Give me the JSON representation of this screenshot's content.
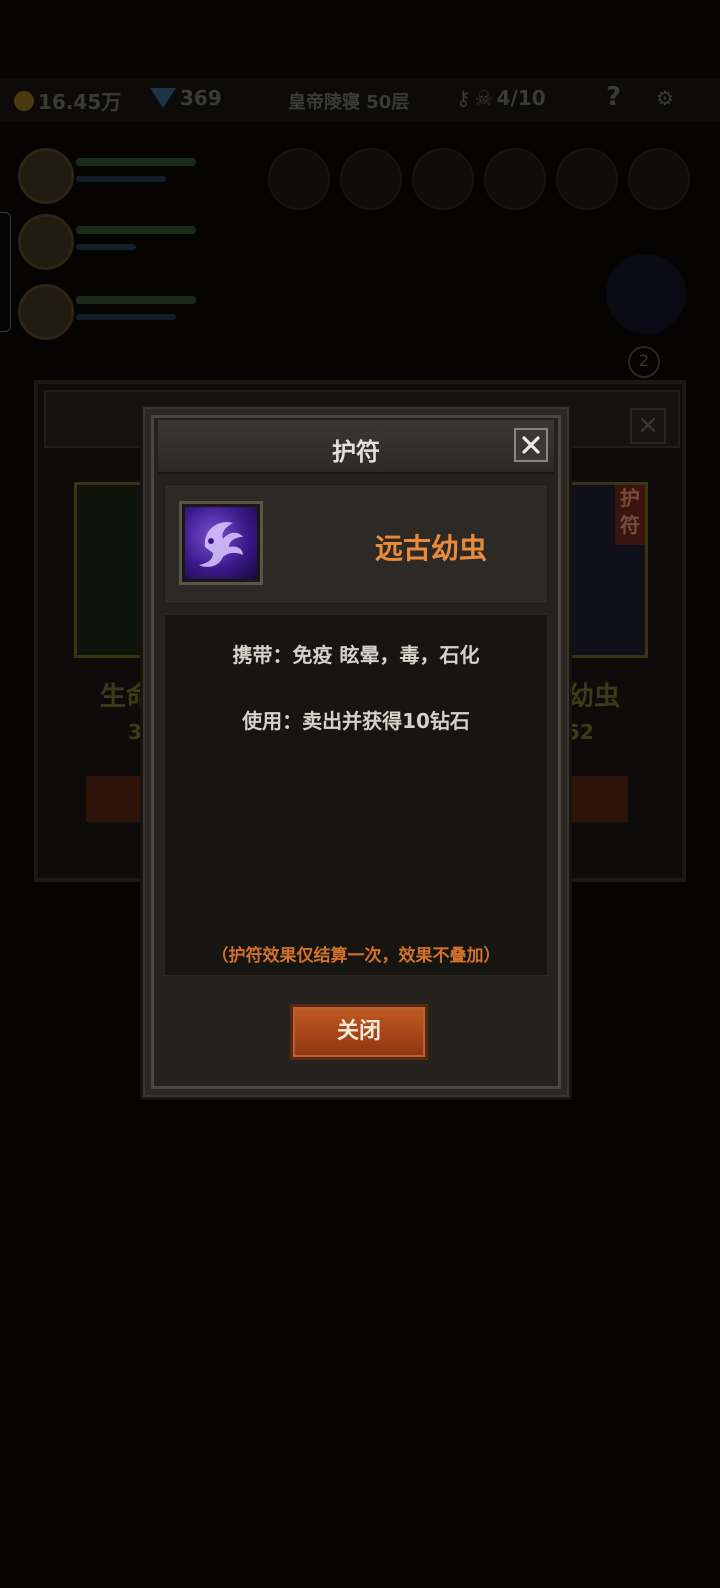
{
  "topbar": {
    "gold": "16.45万",
    "diamonds": "369",
    "stage": "皇帝陵寝 50层",
    "keys": "4/10",
    "help": "?"
  },
  "background_panel": {
    "left_card_name": "生命",
    "left_card_cost": "3",
    "right_card_name": "幼虫",
    "right_card_cost": "52",
    "right_card_tag": "护符",
    "badge": "2"
  },
  "dialog": {
    "title": "护符",
    "item_name": "远古幼虫",
    "carry_text": "携带：免疫 眩晕，毒，石化",
    "use_text": "使用：卖出并获得10钻石",
    "note": "（护符效果仅结算一次，效果不叠加）",
    "close_button": "关闭"
  },
  "colors": {
    "item_name": "#e98b3a",
    "note": "#d2722a",
    "button": "#b04a1a"
  },
  "icons": {
    "close": "close-icon",
    "item": "ancient-larva-icon"
  }
}
